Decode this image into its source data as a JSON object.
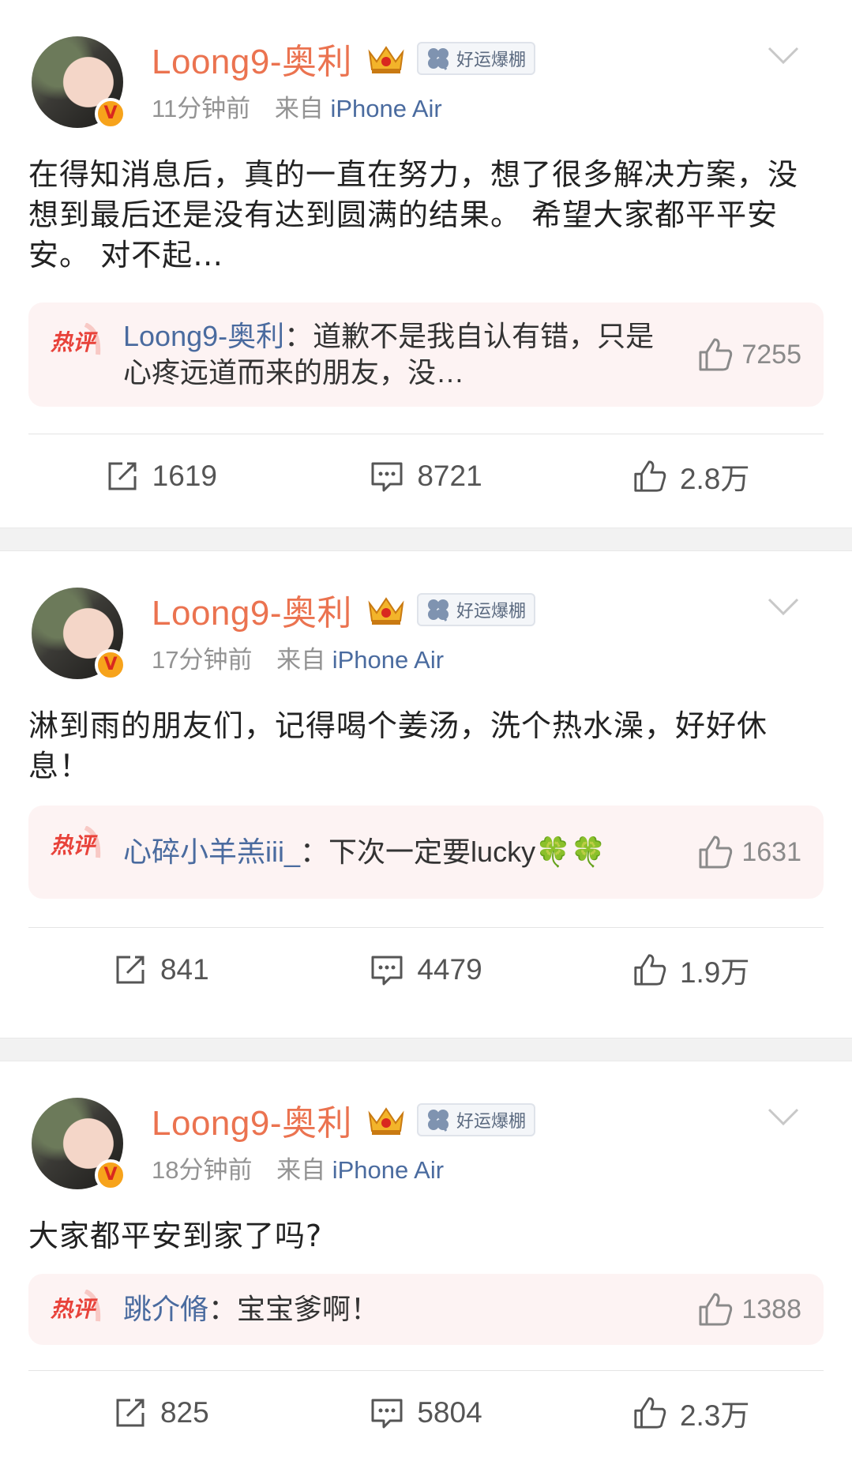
{
  "posts": [
    {
      "username": "Loong9-奥利",
      "badge": "好运爆棚",
      "time": "11分钟前",
      "source_prefix": "来自",
      "device": "iPhone Air",
      "content": "在得知消息后，真的一直在努力，想了很多解决方案，没想到最后还是没有达到圆满的结果。 希望大家都平平安安。 对不起…",
      "hot_label": "热评",
      "hot_user": "Loong9-奥利",
      "hot_sep": "：",
      "hot_text": "道歉不是我自认有错，只是心疼远道而来的朋友，没…",
      "hot_likes": "7255",
      "reposts": "1619",
      "comments": "8721",
      "likes": "2.8万"
    },
    {
      "username": "Loong9-奥利",
      "badge": "好运爆棚",
      "time": "17分钟前",
      "source_prefix": "来自",
      "device": "iPhone Air",
      "content": "淋到雨的朋友们，记得喝个姜汤，洗个热水澡，好好休息！",
      "hot_label": "热评",
      "hot_user": "心碎小羊羔iii_",
      "hot_sep": "：",
      "hot_text": "下次一定要lucky🍀🍀",
      "hot_likes": "1631",
      "reposts": "841",
      "comments": "4479",
      "likes": "1.9万"
    },
    {
      "username": "Loong9-奥利",
      "badge": "好运爆棚",
      "time": "18分钟前",
      "source_prefix": "来自",
      "device": "iPhone Air",
      "content": "大家都平安到家了吗?",
      "hot_label": "热评",
      "hot_user": "跳介脩",
      "hot_sep": "：",
      "hot_text": "宝宝爹啊！",
      "hot_likes": "1388",
      "reposts": "825",
      "comments": "5804",
      "likes": "2.3万"
    }
  ],
  "colors": {
    "username": "#eb7350",
    "link": "#4a6b9f",
    "hot_bg": "#fdf3f3",
    "hot_tag": "#e8423a",
    "verified": "#f7a31b"
  },
  "icons": [
    "verified-v-icon",
    "crown-icon",
    "clover-icon",
    "chevron-down-icon",
    "hot-comment-icon",
    "thumbs-up-icon",
    "repost-icon",
    "comment-icon"
  ]
}
